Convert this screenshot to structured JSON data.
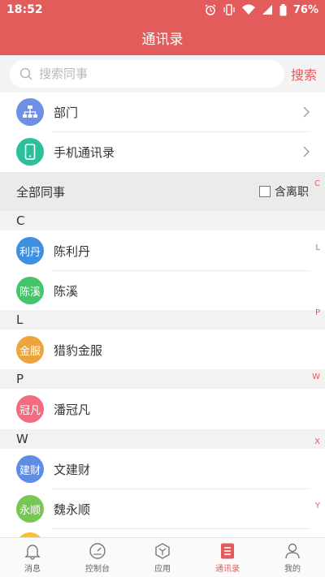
{
  "status_bar": {
    "time": "18:52",
    "battery": "76%"
  },
  "header": {
    "title": "通讯录"
  },
  "search": {
    "placeholder": "搜索同事",
    "button": "搜索"
  },
  "nav_rows": [
    {
      "label": "部门",
      "icon": "org-chart-icon",
      "color": "#6d8fe6"
    },
    {
      "label": "手机通讯录",
      "icon": "phone-icon",
      "color": "#2dbe9a"
    }
  ],
  "all_bar": {
    "title": "全部同事",
    "checkbox_label": "含离职"
  },
  "sections": [
    {
      "letter": "C",
      "contacts": [
        {
          "avatar": "利丹",
          "name": "陈利丹",
          "color": "#3d8fdf"
        },
        {
          "avatar": "陈溪",
          "name": "陈溪",
          "color": "#46c46a"
        }
      ]
    },
    {
      "letter": "L",
      "contacts": [
        {
          "avatar": "金服",
          "name": "猎豹金服",
          "color": "#eea43c"
        }
      ]
    },
    {
      "letter": "P",
      "contacts": [
        {
          "avatar": "冠凡",
          "name": "潘冠凡",
          "color": "#f16d7e"
        }
      ]
    },
    {
      "letter": "W",
      "contacts": [
        {
          "avatar": "建财",
          "name": "文建财",
          "color": "#5f8de6"
        },
        {
          "avatar": "永顺",
          "name": "魏永顺",
          "color": "#78c756"
        }
      ]
    }
  ],
  "index_letters": [
    "C",
    "L",
    "P",
    "W",
    "X",
    "Y"
  ],
  "bottom_nav": [
    {
      "label": "消息",
      "icon": "bell-icon"
    },
    {
      "label": "控制台",
      "icon": "dashboard-icon"
    },
    {
      "label": "应用",
      "icon": "apps-hexagon-icon"
    },
    {
      "label": "通讯录",
      "icon": "contacts-book-icon",
      "active": true
    },
    {
      "label": "我的",
      "icon": "user-icon"
    }
  ],
  "colors": {
    "accent": "#e25c5c",
    "avatar_partial": "#f5c330"
  }
}
